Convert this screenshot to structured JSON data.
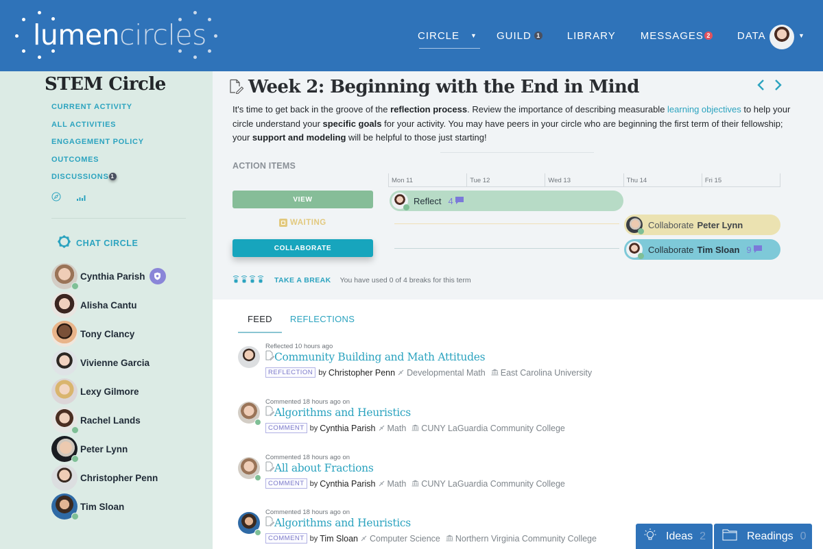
{
  "header": {
    "logo": {
      "word1": "lumen",
      "word2": "circles"
    },
    "nav": [
      {
        "label": "CIRCLE",
        "has_caret": true,
        "active": true
      },
      {
        "label": "GUILD",
        "badge": "1"
      },
      {
        "label": "LIBRARY"
      },
      {
        "label": "MESSAGES",
        "badge": "2"
      },
      {
        "label": "DATA"
      }
    ],
    "profile": {
      "icon": "user-avatar",
      "caret": "▾"
    }
  },
  "sidebar": {
    "title": "STEM Circle",
    "links": [
      {
        "label": "CURRENT ACTIVITY"
      },
      {
        "label": "ALL ACTIVITIES"
      },
      {
        "label": "ENGAGEMENT POLICY"
      },
      {
        "label": "OUTCOMES"
      },
      {
        "label": "DISCUSSIONS",
        "badge": "1"
      }
    ],
    "icons": [
      "compass-icon",
      "bar-chart-icon"
    ],
    "chat": {
      "label": "CHAT CIRCLE",
      "members": [
        {
          "name": "Cynthia Parish",
          "online": true,
          "moderator": true
        },
        {
          "name": "Alisha Cantu",
          "online": false
        },
        {
          "name": "Tony Clancy",
          "online": false
        },
        {
          "name": "Vivienne Garcia",
          "online": false
        },
        {
          "name": "Lexy Gilmore",
          "online": false
        },
        {
          "name": "Rachel Lands",
          "online": true
        },
        {
          "name": "Peter Lynn",
          "online": true
        },
        {
          "name": "Christopher Penn",
          "online": false
        },
        {
          "name": "Tim Sloan",
          "online": true
        }
      ]
    }
  },
  "activity": {
    "title": "Week 2: Beginning with the End in Mind",
    "intro": {
      "p1": "It's time to get back in the groove of the ",
      "b1": "reflection process",
      "p2": ". Review the importance of describing measurable ",
      "link": "learning objectives",
      "p3": " to help your circle understand your ",
      "b2": "specific goals",
      "p4": " for your activity. You may have peers in your circle who are beginning the first term of their fellowship; your ",
      "b3": "support and modeling",
      "p5": " will be helpful to those just starting!"
    },
    "action_items_label": "ACTION ITEMS",
    "calendar_days": [
      "Mon 11",
      "Tue 12",
      "Wed 13",
      "Thu 14",
      "Fri 15"
    ],
    "buttons": {
      "view": "VIEW",
      "waiting": "WAITING",
      "collaborate": "COLLABORATE"
    },
    "timeline": {
      "reflect": {
        "label": "Reflect",
        "comments": "4"
      },
      "peter": {
        "action": "Collaborate",
        "person": "Peter Lynn"
      },
      "tim": {
        "action": "Collaborate",
        "person": "Tim Sloan",
        "comments": "9"
      }
    },
    "break": {
      "label": "TAKE A BREAK",
      "note": "You have used 0 of 4 breaks for this term",
      "used": 0,
      "total": 4
    }
  },
  "feed": {
    "tabs": [
      {
        "label": "FEED",
        "active": true
      },
      {
        "label": "REFLECTIONS",
        "active": false
      }
    ],
    "items": [
      {
        "meta": "Reflected 10 hours ago",
        "title": "Community Building and Math Attitudes",
        "tag": "REFLECTION",
        "by": "by",
        "author": "Christopher Penn",
        "discipline": "Developmental Math",
        "institution": "East Carolina University",
        "online": false
      },
      {
        "meta": "Commented 18 hours ago on",
        "title": "Algorithms and Heuristics",
        "tag": "COMMENT",
        "by": "by",
        "author": "Cynthia Parish",
        "discipline": "Math",
        "institution": "CUNY LaGuardia Community College",
        "online": true
      },
      {
        "meta": "Commented 18 hours ago on",
        "title": "All about Fractions",
        "tag": "COMMENT",
        "by": "by",
        "author": "Cynthia Parish",
        "discipline": "Math",
        "institution": "CUNY LaGuardia Community College",
        "online": true
      },
      {
        "meta": "Commented 18 hours ago on",
        "title": "Algorithms and Heuristics",
        "tag": "COMMENT",
        "by": "by",
        "author": "Tim Sloan",
        "discipline": "Computer Science",
        "institution": "Northern Virginia Community College",
        "online": true
      }
    ]
  },
  "dock": {
    "ideas": {
      "label": "Ideas",
      "count": "2"
    },
    "readings": {
      "label": "Readings",
      "count": "0"
    }
  },
  "colors": {
    "brand_blue": "#2f73b9",
    "teal": "#2ba3bf",
    "sidebar_bg": "#dcebe5",
    "view_green": "#86bd98",
    "waiting_yellow": "#e2c97f",
    "collab_teal": "#17a5bd",
    "moderator_purple": "#8a86d8",
    "online_green": "#7fbf96"
  }
}
